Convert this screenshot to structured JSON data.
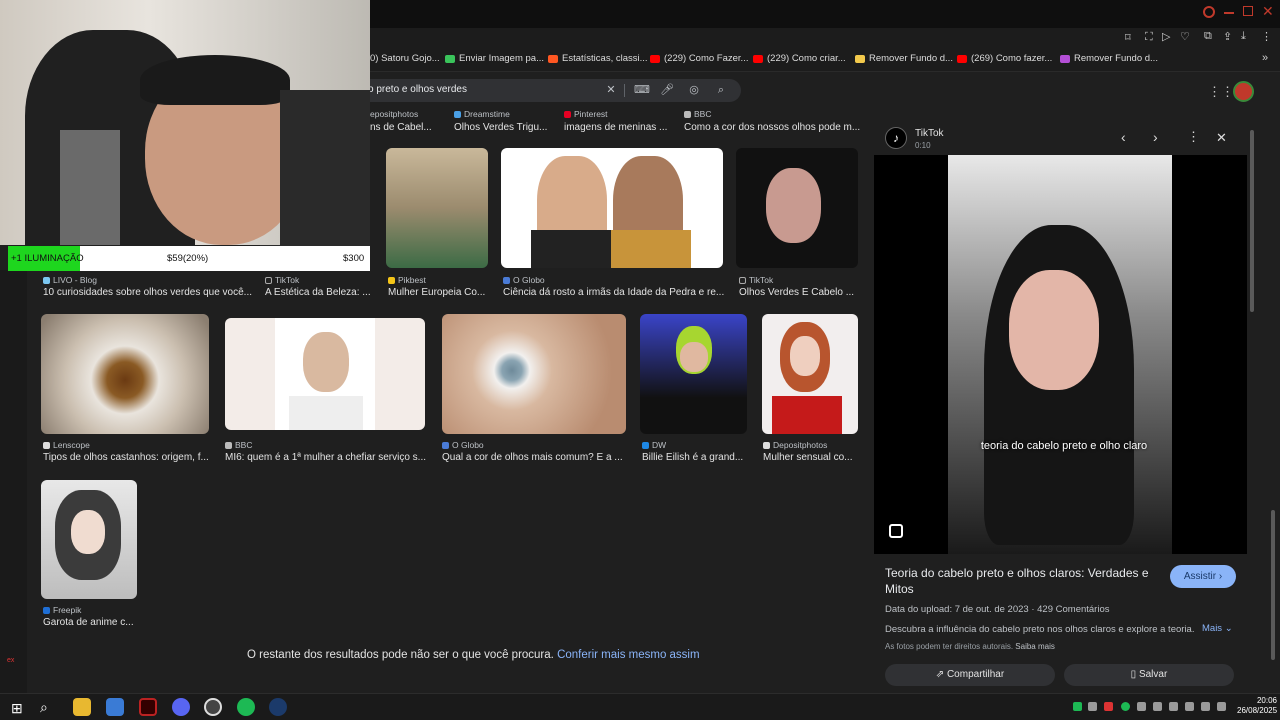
{
  "bookmarks": [
    {
      "label": "0) Satoru Gojo...",
      "color": "#f5a623"
    },
    {
      "label": "Enviar Imagem pa...",
      "color": "#3ac45b"
    },
    {
      "label": "Estatísticas, classi...",
      "color": "#ff5722"
    },
    {
      "label": "(229) Como Fazer...",
      "color": "#ff0000"
    },
    {
      "label": "(229) Como criar...",
      "color": "#ff0000"
    },
    {
      "label": "Remover Fundo d...",
      "color": "#f2c94c"
    },
    {
      "label": "(269) Como fazer...",
      "color": "#ff0000"
    },
    {
      "label": "Remover Fundo d...",
      "color": "#b44fd6"
    }
  ],
  "search": {
    "query": "o preto e olhos verdes"
  },
  "row0": [
    {
      "source": "epositphotos",
      "title": "ns de Cabel..."
    },
    {
      "source": "Dreamstime",
      "title": "Olhos Verdes Trigu..."
    },
    {
      "source": "Pinterest",
      "title": "imagens de meninas ..."
    },
    {
      "source": "BBC",
      "title": "Como a cor dos nossos olhos pode m..."
    }
  ],
  "row1": [
    {
      "source": "LIVO - Blog",
      "title": "10 curiosidades sobre olhos verdes que você..."
    },
    {
      "source": "TikTok",
      "title": "A Estética da Beleza: ..."
    },
    {
      "source": "Pikbest",
      "title": "Mulher Europeia Co..."
    },
    {
      "source": "O Globo",
      "title": "Ciência dá rosto a irmãs da Idade da Pedra e re..."
    },
    {
      "source": "TikTok",
      "title": "Olhos Verdes E Cabelo ..."
    }
  ],
  "row2": [
    {
      "source": "Lenscope",
      "title": "Tipos de olhos castanhos: origem, f..."
    },
    {
      "source": "BBC",
      "title": "MI6: quem é a 1ª mulher a chefiar serviço s..."
    },
    {
      "source": "O Globo",
      "title": "Qual a cor de olhos mais comum? E a ..."
    },
    {
      "source": "DW",
      "title": "Billie Eilish é a grand..."
    },
    {
      "source": "Depositphotos",
      "title": "Mulher sensual co..."
    }
  ],
  "row3": [
    {
      "source": "Freepik",
      "title": "Garota de anime c..."
    }
  ],
  "footer": {
    "text": "O restante dos resultados pode não ser o que você procura.",
    "link": "Conferir mais mesmo assim"
  },
  "overlay": {
    "goal_label": "+1 ILUMINAÇÃO",
    "progress_text": "$59(20%)",
    "goal_amount": "$300",
    "progress": 0.2
  },
  "panel": {
    "source": "TikTok",
    "duration": "0:10",
    "caption": "teoria do cabelo preto e olho claro",
    "title": "Teoria do cabelo preto e olhos claros: Verdades e Mitos",
    "watch": "Assistir",
    "upload_date": "Data do upload: 7 de out. de 2023",
    "comments": "429 Comentários",
    "description": "Descubra a influência do cabelo preto nos olhos claros e explore a teoria...",
    "more": "Mais",
    "rights": "As fotos podem ter direitos autorais.",
    "learn_more": "Saiba mais",
    "share": "Compartilhar",
    "save": "Salvar"
  },
  "taskbar": {
    "time": "20:06",
    "date": "26/08/2025"
  },
  "left_strip": {
    "label1": "ex"
  }
}
